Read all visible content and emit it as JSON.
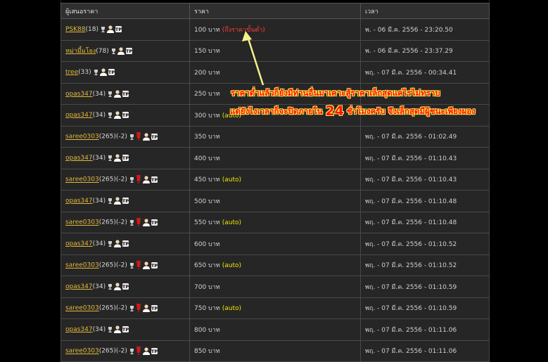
{
  "headers": {
    "bidder": "ผู้เสนอราคา",
    "price": "ราคา",
    "time": "เวลา"
  },
  "rows": [
    {
      "name": "PSK88",
      "score": "(18)",
      "alert": false,
      "price": "100 บาท",
      "note": "(ถึงราคาขั้นต่ำ)",
      "note_type": "reserve",
      "time": "พ. - 06 มี.ค. 2556 - 23:20.50"
    },
    {
      "name": "หม่ามี้มโยง",
      "score": "(78)",
      "alert": false,
      "price": "150 บาท",
      "note": "",
      "note_type": "",
      "time": "พ. - 06 มี.ค. 2556 - 23:37.29"
    },
    {
      "name": "tree",
      "score": "(33)",
      "alert": false,
      "price": "200 บาท",
      "note": "",
      "note_type": "",
      "time": "พฤ. - 07 มี.ค. 2556 - 00:34.41"
    },
    {
      "name": "opas347",
      "score": "(34)",
      "alert": false,
      "price": "250 บาท",
      "note": "",
      "note_type": "",
      "time": ""
    },
    {
      "name": "opas347",
      "score": "(34)",
      "alert": false,
      "price": "300 บาท",
      "note": "(auto)",
      "note_type": "auto",
      "time": ""
    },
    {
      "name": "saree0303",
      "score": "(265)(-2)",
      "alert": true,
      "price": "350 บาท",
      "note": "",
      "note_type": "",
      "time": "พฤ. - 07 มี.ค. 2556 - 01:02.49"
    },
    {
      "name": "opas347",
      "score": "(34)",
      "alert": false,
      "price": "400 บาท",
      "note": "",
      "note_type": "",
      "time": "พฤ. - 07 มี.ค. 2556 - 01:10.43"
    },
    {
      "name": "saree0303",
      "score": "(265)(-2)",
      "alert": true,
      "price": "450 บาท",
      "note": "(auto)",
      "note_type": "auto",
      "time": "พฤ. - 07 มี.ค. 2556 - 01:10.43"
    },
    {
      "name": "opas347",
      "score": "(34)",
      "alert": false,
      "price": "500 บาท",
      "note": "",
      "note_type": "",
      "time": "พฤ. - 07 มี.ค. 2556 - 01:10.48"
    },
    {
      "name": "saree0303",
      "score": "(265)(-2)",
      "alert": true,
      "price": "550 บาท",
      "note": "(auto)",
      "note_type": "auto",
      "time": "พฤ. - 07 มี.ค. 2556 - 01:10.48"
    },
    {
      "name": "opas347",
      "score": "(34)",
      "alert": false,
      "price": "600 บาท",
      "note": "",
      "note_type": "",
      "time": "พฤ. - 07 มี.ค. 2556 - 01:10.52"
    },
    {
      "name": "saree0303",
      "score": "(265)(-2)",
      "alert": true,
      "price": "650 บาท",
      "note": "(auto)",
      "note_type": "auto",
      "time": "พฤ. - 07 มี.ค. 2556 - 01:10.52"
    },
    {
      "name": "opas347",
      "score": "(34)",
      "alert": false,
      "price": "700 บาท",
      "note": "",
      "note_type": "",
      "time": "พฤ. - 07 มี.ค. 2556 - 01:10.59"
    },
    {
      "name": "saree0303",
      "score": "(265)(-2)",
      "alert": true,
      "price": "750 บาท",
      "note": "(auto)",
      "note_type": "auto",
      "time": "พฤ. - 07 มี.ค. 2556 - 01:10.59"
    },
    {
      "name": "opas347",
      "score": "(34)",
      "alert": false,
      "price": "800 บาท",
      "note": "",
      "note_type": "",
      "time": "พฤ. - 07 มี.ค. 2556 - 01:11.06"
    },
    {
      "name": "saree0303",
      "score": "(265)(-2)",
      "alert": true,
      "price": "850 บาท",
      "note": "",
      "note_type": "",
      "time": "พฤ. - 07 มี.ค. 2556 - 01:11.06"
    }
  ],
  "annotation": {
    "line1": "ราคาต่ำแล้วก็ยังมีท่านอื่นมาเคาะสู้ราคาเล็กสุดแค่ไรไม่ทราบ",
    "line2_a": "แต่ยังไงเวลาก็จะปิดภายใน",
    "line2_num": "24",
    "line2_b": "ชั่วโมงครับ จึงเล็กสุดมีผู้ชนะเพียงผอง"
  },
  "colors": {
    "link": "#e2b93a",
    "auto_note": "#f2e600",
    "reserve_note": "#ff3a3a",
    "annotation_text": "#ff1010",
    "annotation_outline": "#ffe94a",
    "arrow": "#f5f08a"
  },
  "icons": [
    "trophy-icon",
    "alert-icon",
    "person-icon",
    "tp-badge-icon",
    "arrow-icon"
  ]
}
